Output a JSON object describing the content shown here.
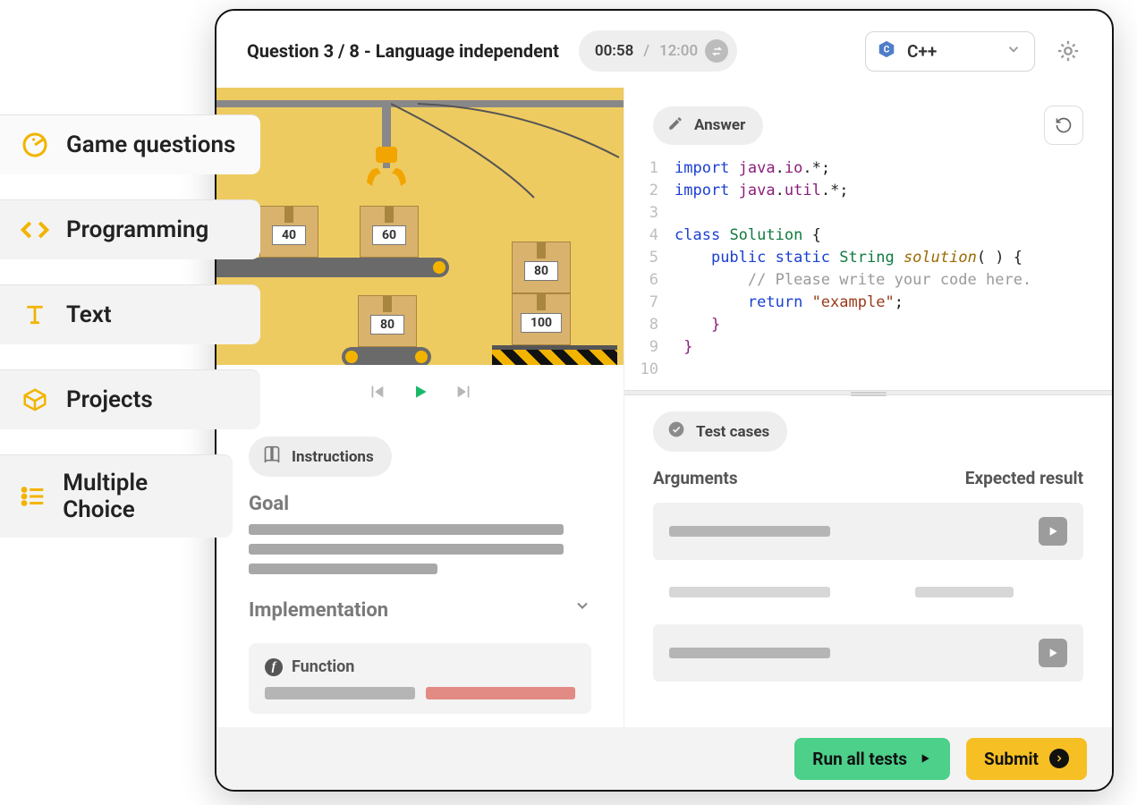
{
  "sidebar": {
    "items": [
      {
        "label": "Game questions"
      },
      {
        "label": "Programming"
      },
      {
        "label": "Text"
      },
      {
        "label": "Projects"
      },
      {
        "label": "Multiple Choice"
      }
    ]
  },
  "header": {
    "question_label": "Question 3 / 8 - Language independent",
    "timer_elapsed": "00:58",
    "timer_max": "12:00",
    "language": "C++"
  },
  "animation": {
    "box1": "40",
    "box2": "60",
    "box3": "80",
    "box4": "80",
    "box5": "100"
  },
  "answer": {
    "title": "Answer"
  },
  "code": {
    "lines": [
      {
        "n": "1",
        "segs": [
          [
            "kw",
            "import"
          ],
          [
            "punc",
            " "
          ],
          [
            "prop",
            "java"
          ],
          [
            "punc",
            "."
          ],
          [
            "prop",
            "io"
          ],
          [
            "punc",
            ".*;"
          ]
        ]
      },
      {
        "n": "2",
        "segs": [
          [
            "kw",
            "import"
          ],
          [
            "punc",
            " "
          ],
          [
            "prop",
            "java"
          ],
          [
            "punc",
            "."
          ],
          [
            "prop",
            "util"
          ],
          [
            "punc",
            ".*;"
          ]
        ]
      },
      {
        "n": "3",
        "segs": [
          [
            "punc",
            ""
          ]
        ]
      },
      {
        "n": "4",
        "segs": [
          [
            "kw",
            "class"
          ],
          [
            "punc",
            " "
          ],
          [
            "type",
            "Solution"
          ],
          [
            "punc",
            " {"
          ]
        ]
      },
      {
        "n": "5",
        "segs": [
          [
            "punc",
            "    "
          ],
          [
            "kw",
            "public static"
          ],
          [
            "punc",
            " "
          ],
          [
            "type",
            "String"
          ],
          [
            "punc",
            " "
          ],
          [
            "fn",
            "solution"
          ],
          [
            "punc",
            "( ) {"
          ]
        ]
      },
      {
        "n": "6",
        "segs": [
          [
            "punc",
            "        "
          ],
          [
            "cm",
            "// Please write your code here."
          ]
        ]
      },
      {
        "n": "7",
        "segs": [
          [
            "punc",
            "        "
          ],
          [
            "kw",
            "return"
          ],
          [
            "punc",
            " "
          ],
          [
            "str",
            "\"example\""
          ],
          [
            "punc",
            ";"
          ]
        ]
      },
      {
        "n": "8",
        "segs": [
          [
            "punc",
            "    "
          ],
          [
            "prop",
            "}"
          ]
        ]
      },
      {
        "n": "9",
        "segs": [
          [
            "punc",
            " "
          ],
          [
            "prop",
            "}"
          ]
        ]
      },
      {
        "n": "10",
        "segs": [
          [
            "punc",
            ""
          ]
        ]
      }
    ]
  },
  "instructions": {
    "title": "Instructions",
    "goal_heading": "Goal",
    "impl_heading": "Implementation",
    "function_heading": "Function"
  },
  "testcases": {
    "title": "Test cases",
    "col_args": "Arguments",
    "col_expected": "Expected result"
  },
  "footer": {
    "run": "Run all tests",
    "submit": "Submit"
  }
}
